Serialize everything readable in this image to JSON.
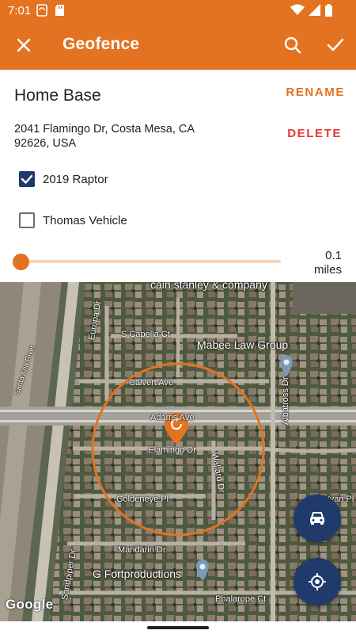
{
  "status_bar": {
    "time": "7:01",
    "icons": [
      "sync-icon",
      "sd-card-icon",
      "wifi-icon",
      "signal-icon",
      "battery-icon"
    ]
  },
  "app_bar": {
    "title": "Geofence",
    "left_icon": "close-icon",
    "right_icons": [
      "search-icon",
      "check-icon"
    ],
    "background_color": "#e37221"
  },
  "geofence": {
    "name": "Home Base",
    "rename_label": "RENAME",
    "address": "2041 Flamingo Dr, Costa Mesa, CA 92626, USA",
    "delete_label": "DELETE",
    "vehicles": [
      {
        "label": "2019 Raptor",
        "checked": true
      },
      {
        "label": "Thomas Vehicle",
        "checked": false
      }
    ],
    "radius": {
      "value": "0.1",
      "unit": "miles",
      "slider_fraction": 0.0
    }
  },
  "map": {
    "street_labels": [
      "S Capella Ct",
      "Europa Dr",
      "Calvert Ave",
      "Adams Ave",
      "Flamingo Dr",
      "Wallard Dr",
      "Albatross Dr",
      "Goldeneye Pl",
      "Mandarin Dr",
      "Sandpiper Dr",
      "Phalarope Ct",
      "Santa Ana River",
      "Yvan Pl"
    ],
    "poi_labels": [
      "Mabee Law Group",
      "G Fortproductions",
      "cain stanley & company"
    ],
    "attribution": "Google",
    "marker_icon": "refresh-marker-icon",
    "geofence_circle_color": "#e37221"
  },
  "fabs": [
    {
      "name": "vehicle-button",
      "icon": "car-icon"
    },
    {
      "name": "my-location-button",
      "icon": "gps-target-icon"
    }
  ],
  "colors": {
    "accent": "#e37221",
    "delete": "#e53935",
    "fab": "#1f3a6b",
    "checkbox_checked": "#1f3a6b"
  }
}
